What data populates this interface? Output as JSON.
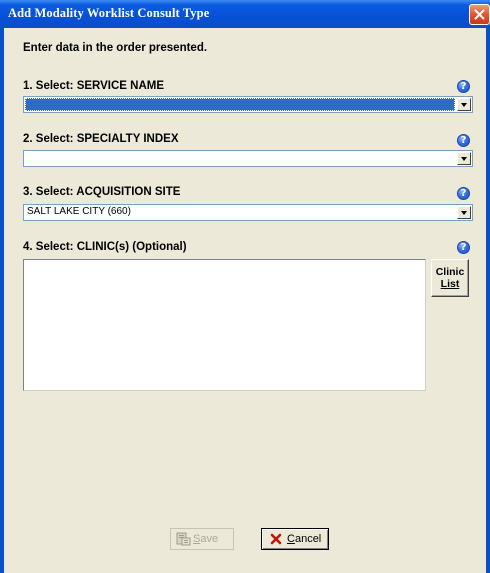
{
  "window": {
    "title": "Add Modality Worklist Consult Type",
    "close_icon": "close-icon"
  },
  "instructions": "Enter data in the order presented.",
  "fields": {
    "service_name": {
      "label": "1. Select: SERVICE NAME",
      "value": "",
      "selected": true,
      "help_icon": "help-icon"
    },
    "specialty_index": {
      "label": "2. Select: SPECIALTY INDEX",
      "value": "",
      "help_icon": "help-icon"
    },
    "acquisition_site": {
      "label": "3. Select: ACQUISITION SITE",
      "value": "SALT LAKE CITY (660)",
      "help_icon": "help-icon"
    },
    "clinics": {
      "label": "4. Select: CLINIC(s) (Optional)",
      "items": [],
      "help_icon": "help-icon"
    }
  },
  "buttons": {
    "clinic_list_line1": "Clinic",
    "clinic_list_line2": "List",
    "save": {
      "label": "Save",
      "enabled": false,
      "icon": "save-icon"
    },
    "cancel": {
      "label": "Cancel",
      "enabled": true,
      "icon": "cancel-x-icon"
    }
  },
  "colors": {
    "title_bar": "#0a4fc4",
    "selection": "#316ac5",
    "face": "#ece9d8",
    "close_button": "#e0552f"
  }
}
